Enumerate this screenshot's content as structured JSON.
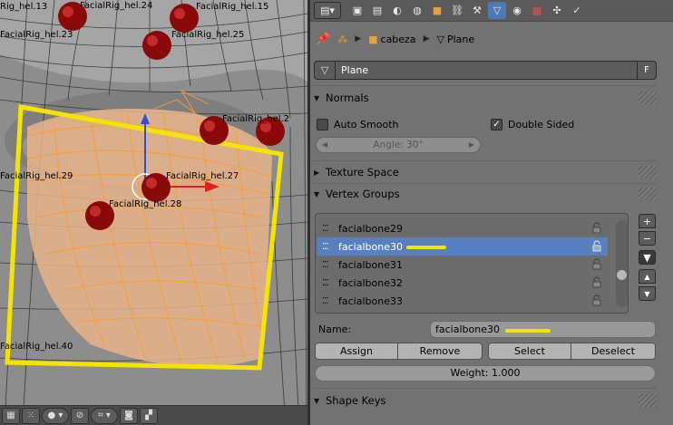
{
  "viewport": {
    "bone_labels": [
      {
        "text": "Rig_hel.13"
      },
      {
        "text": "FacialRig_hel.24"
      },
      {
        "text": "FacialRig_hel.15"
      },
      {
        "text": "FacialRig_hel.23"
      },
      {
        "text": "FacialRig_hel.25"
      },
      {
        "text": "FacialRig_hel.27"
      },
      {
        "text": "FacialRig_hel.29"
      },
      {
        "text": "FacialRig_hel.28"
      },
      {
        "text": "FacialRig_hel.40"
      },
      {
        "text": "FacialRig_hel.2"
      }
    ],
    "footer_icons": [
      "cube-icon",
      "vertex-select-icon",
      "shading-icon",
      "snap-icon",
      "grid-icon",
      "camera-render-icon",
      "clapboard-icon"
    ]
  },
  "properties": {
    "tabs": [
      {
        "name": "render-tab",
        "glyph": "▤"
      },
      {
        "name": "render-layers-tab",
        "glyph": "▣"
      },
      {
        "name": "scene-tab",
        "glyph": "◐"
      },
      {
        "name": "world-tab",
        "glyph": "●"
      },
      {
        "name": "object-tab",
        "glyph": "■"
      },
      {
        "name": "constraints-tab",
        "glyph": "⛓"
      },
      {
        "name": "modifiers-tab",
        "glyph": "🔧"
      },
      {
        "name": "data-tab",
        "glyph": "▽"
      },
      {
        "name": "material-tab",
        "glyph": "◉"
      },
      {
        "name": "texture-tab",
        "glyph": "▦"
      },
      {
        "name": "particles-tab",
        "glyph": "✣"
      },
      {
        "name": "physics-tab",
        "glyph": "✓"
      }
    ],
    "breadcrumb": {
      "object": "cabeza",
      "mesh": "Plane"
    },
    "mesh_name": "Plane",
    "fake_user": "F",
    "normals": {
      "title": "Normals",
      "auto_smooth": "Auto Smooth",
      "double_sided": "Double Sided",
      "angle": "Angle: 30°"
    },
    "texture_space": {
      "title": "Texture Space"
    },
    "vertex_groups": {
      "title": "Vertex Groups",
      "items": [
        "facialbone29",
        "facialbone30",
        "facialbone31",
        "facialbone32",
        "facialbone33"
      ],
      "selected_index": 1,
      "name_label": "Name:",
      "name_value": "facialbone30",
      "assign": "Assign",
      "remove": "Remove",
      "select": "Select",
      "deselect": "Deselect",
      "weight": "Weight: 1.000"
    },
    "shape_keys": {
      "title": "Shape Keys"
    }
  },
  "colors": {
    "selection_blue": "#5680c2",
    "active_tab": "#4e79b8",
    "highlight_yellow": "#f4e400",
    "mesh_orange": "#ff9a2a"
  }
}
